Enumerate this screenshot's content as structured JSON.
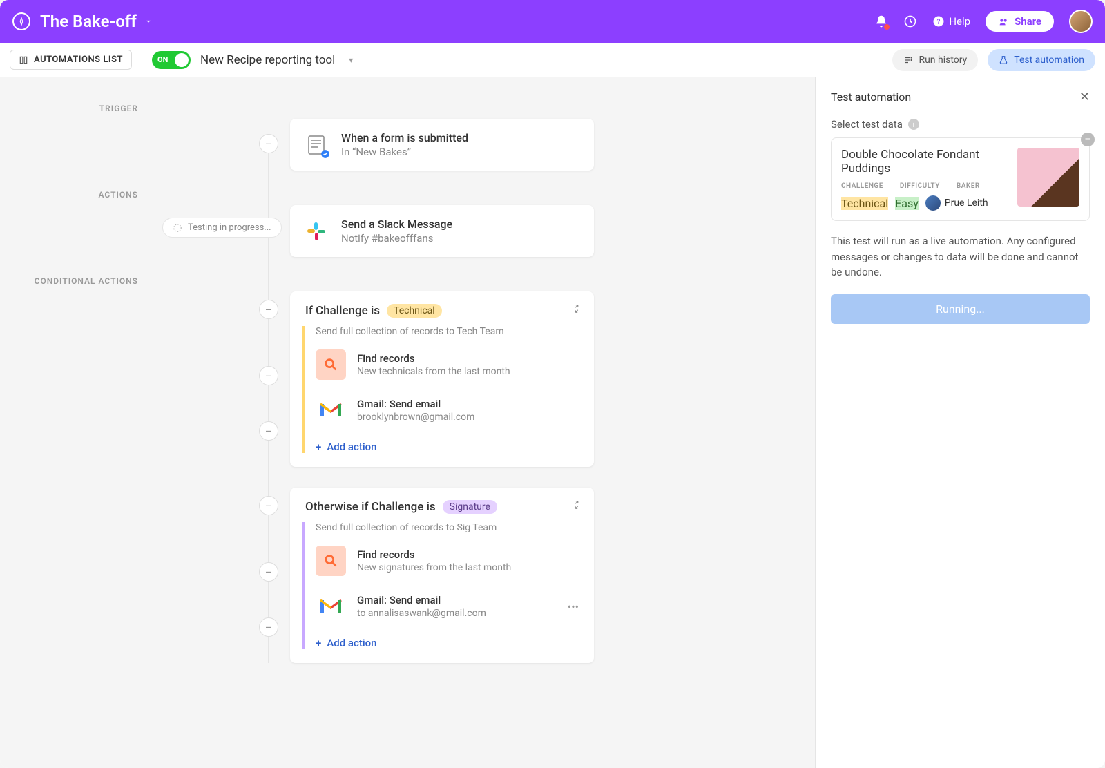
{
  "header": {
    "title": "The Bake-off",
    "help_label": "Help",
    "share_label": "Share"
  },
  "toolbar": {
    "list_button": "AUTOMATIONS LIST",
    "toggle_label": "ON",
    "automation_name": "New Recipe reporting tool",
    "run_history_label": "Run history",
    "test_automation_label": "Test automation"
  },
  "flow": {
    "trigger_label": "TRIGGER",
    "actions_label": "ACTIONS",
    "conditional_label": "CONDITIONAL ACTIONS",
    "testing_chip": "Testing in progress...",
    "trigger": {
      "title": "When a form is submitted",
      "sub": "In “New Bakes”"
    },
    "slack": {
      "title": "Send a Slack Message",
      "sub": "Notify #bakeofffans"
    },
    "cond1": {
      "header_prefix": "If Challenge is",
      "tag": "Technical",
      "desc": "Send full collection of records to Tech Team",
      "find_title": "Find records",
      "find_sub": "New technicals from the last month",
      "gmail_title": "Gmail: Send email",
      "gmail_sub": "brooklynbrown@gmail.com",
      "add_action": "Add action"
    },
    "cond2": {
      "header_prefix": "Otherwise if Challenge is",
      "tag": "Signature",
      "desc": "Send full collection of records to Sig Team",
      "find_title": "Find records",
      "find_sub": "New signatures from the last month",
      "gmail_title": "Gmail: Send email",
      "gmail_sub": "to annalisaswank@gmail.com",
      "add_action": "Add action"
    }
  },
  "panel": {
    "title": "Test automation",
    "select_label": "Select test data",
    "record_title": "Double Chocolate Fondant Puddings",
    "field_challenge": "CHALLENGE",
    "field_difficulty": "DIFFICULTY",
    "field_baker": "BAKER",
    "challenge_value": "Technical",
    "difficulty_value": "Easy",
    "baker_value": "Prue Leith",
    "warning_text": "This test will run as a live automation. Any configured messages or changes to data will be done and cannot be undone.",
    "button_label": "Running..."
  }
}
